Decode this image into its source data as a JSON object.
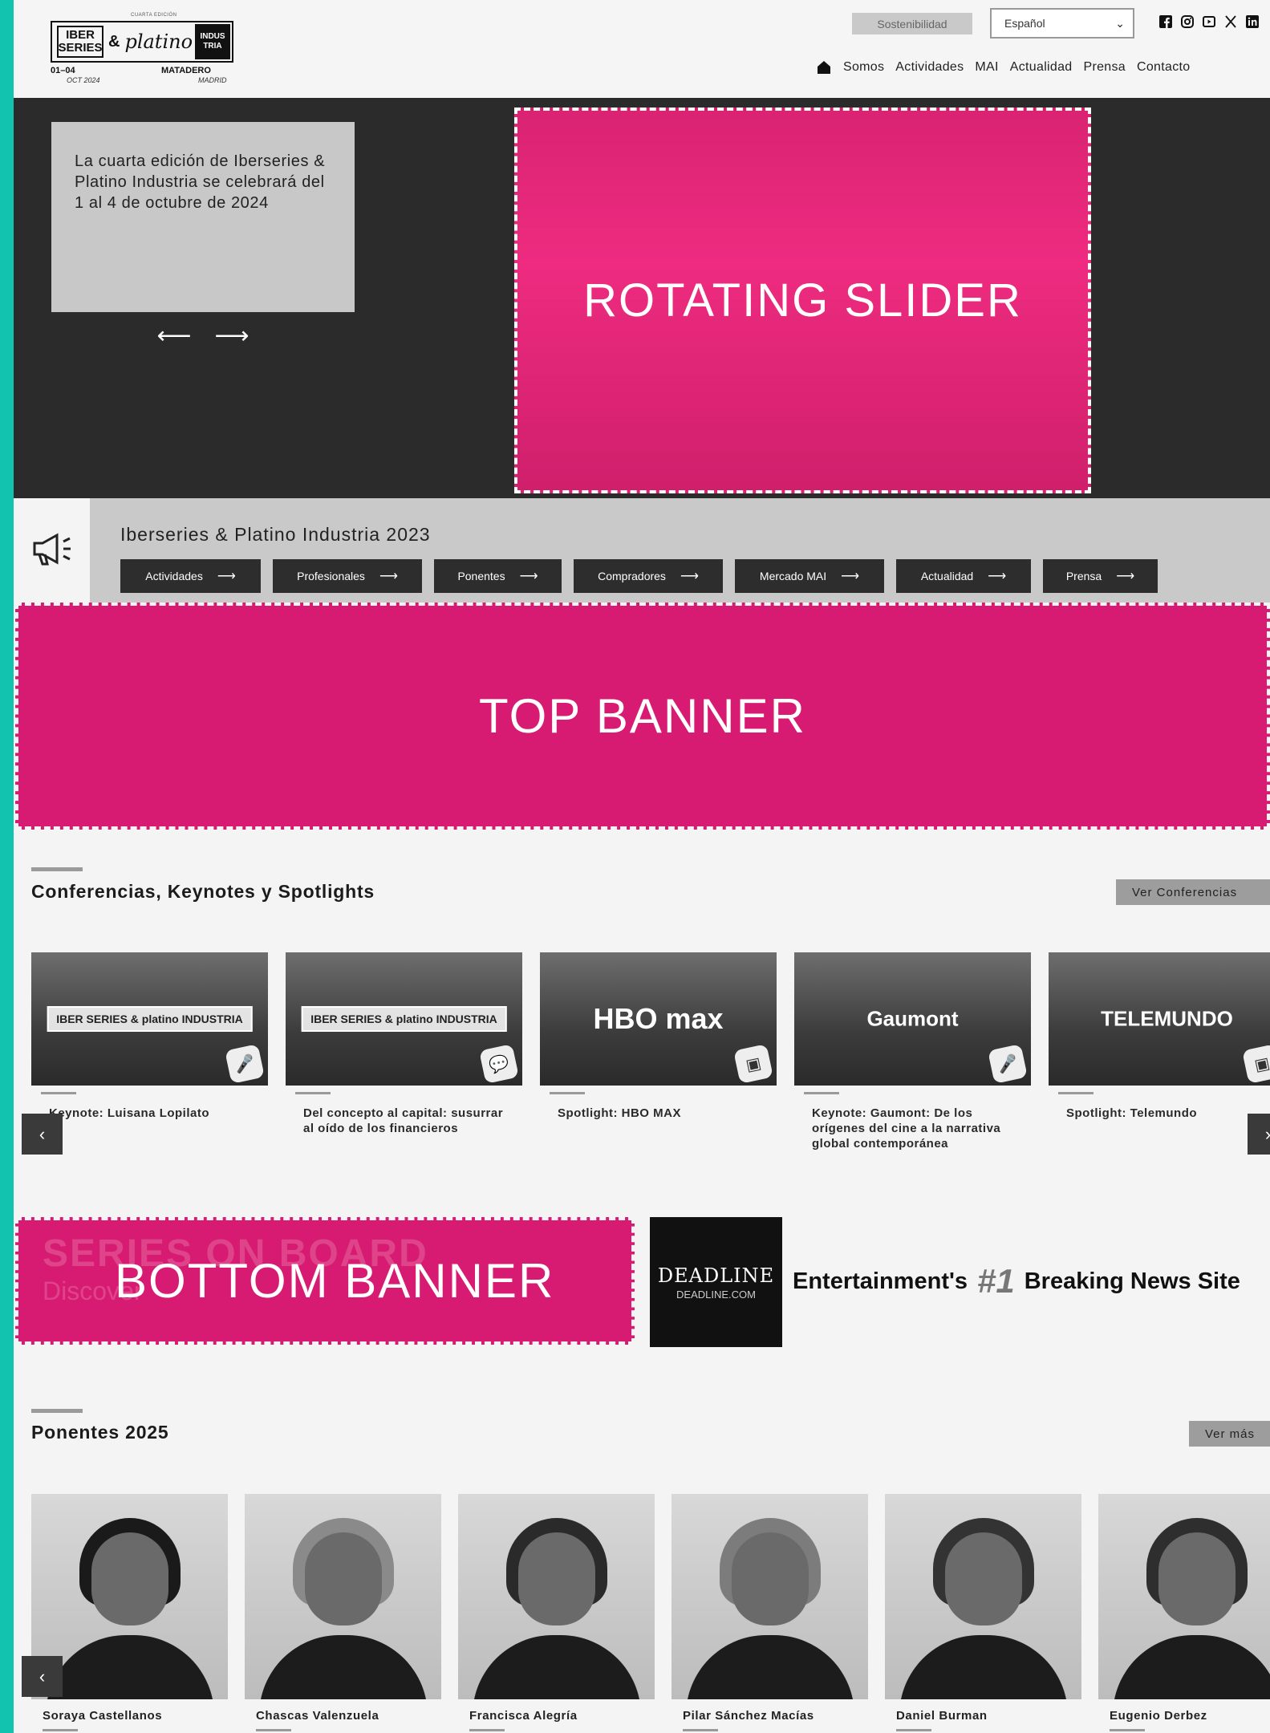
{
  "header": {
    "logo": {
      "edition": "CUARTA EDICIÓN",
      "iber": "IBER SERIES",
      "amp": "&",
      "platino": "platino",
      "industria": "INDUS TRIA",
      "dates": "01–04",
      "month": "OCT 2024",
      "venue": "MATADERO",
      "city": "MADRID"
    },
    "sostenibilidad_label": "Sostenibilidad",
    "language": {
      "selected": "Español"
    },
    "socials": [
      "facebook-icon",
      "instagram-icon",
      "youtube-icon",
      "x-icon",
      "linkedin-icon"
    ],
    "nav": [
      "Somos",
      "Actividades",
      "MAI",
      "Actualidad",
      "Prensa",
      "Contacto"
    ]
  },
  "hero": {
    "card_text": "La cuarta edición de Iberseries & Platino Industria se celebrará del 1 al 4 de octubre de 2024",
    "prev_arrow": "⟵",
    "next_arrow": "⟶",
    "slider_label": "ROTATING SLIDER"
  },
  "quick_links": {
    "title": "Iberseries & Platino Industria 2023",
    "buttons": [
      {
        "label": "Actividades",
        "width": 175
      },
      {
        "label": "Profesionales",
        "width": 186
      },
      {
        "label": "Ponentes",
        "width": 159
      },
      {
        "label": "Compradores",
        "width": 186
      },
      {
        "label": "Mercado MAI",
        "width": 186
      },
      {
        "label": "Actualidad",
        "width": 168
      },
      {
        "label": "Prensa",
        "width": 143
      }
    ],
    "arrow": "⟶"
  },
  "top_banner": {
    "label": "TOP BANNER"
  },
  "conferencias": {
    "title": "Conferencias, Keynotes y Spotlights",
    "ver_label": "Ver Conferencias",
    "prev": "‹",
    "next": "›",
    "cards": [
      {
        "title": "Keynote: Luisana Lopilato",
        "brand": "IBER SERIES & platino INDUSTRIA",
        "badge": "🎤"
      },
      {
        "title": "Del concepto al capital: susurrar al oído de los financieros",
        "brand": "IBER SERIES & platino INDUSTRIA",
        "badge": "💬"
      },
      {
        "title": "Spotlight: HBO MAX",
        "brand": "HBO max",
        "badge": "▣"
      },
      {
        "title": "Keynote: Gaumont: De los orígenes del cine a la narrativa global contemporánea",
        "brand": "Gaumont",
        "badge": "🎤"
      },
      {
        "title": "Spotlight: Telemundo",
        "brand": "TELEMUNDO",
        "badge": "▣"
      }
    ]
  },
  "bottom_banner": {
    "label": "BOTTOM BANNER",
    "ghost_title": "SERIES ON BOARD",
    "ghost_sub": "Discover"
  },
  "deadline_ad": {
    "logo": "DEADLINE",
    "logo_sub": "DEADLINE.COM",
    "tag_left": "Entertainment's",
    "tag_num": "#1",
    "tag_right": "Breaking News Site"
  },
  "ponentes": {
    "title": "Ponentes 2025",
    "ver_label": "Ver más",
    "prev": "‹",
    "people": [
      "Soraya Castellanos",
      "Chascas Valenzuela",
      "Francisca Alegría",
      "Pilar Sánchez Macías",
      "Daniel Burman",
      "Eugenio Derbez"
    ]
  }
}
